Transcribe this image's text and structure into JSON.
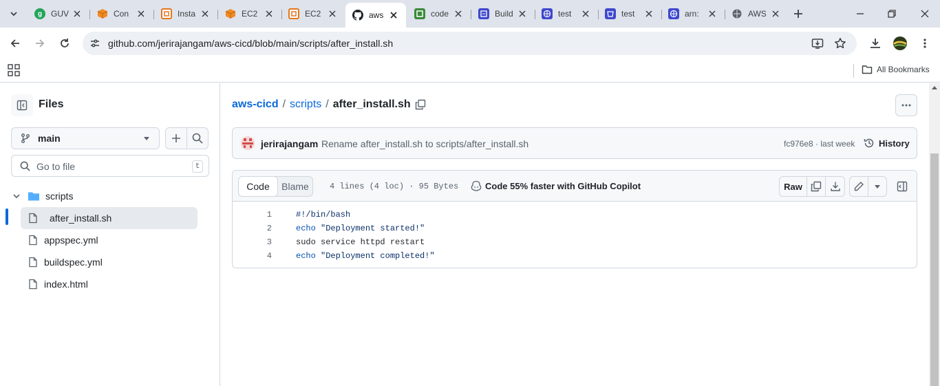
{
  "browser": {
    "tabs": [
      {
        "label": "GUVI",
        "favicon": "guvi-icon",
        "color": "#22a55b",
        "active": false
      },
      {
        "label": "Con",
        "favicon": "aws-cube-icon",
        "color": "#f08a24",
        "active": false
      },
      {
        "label": "Insta",
        "favicon": "aws-ec2-icon",
        "color": "#e2771f",
        "active": false
      },
      {
        "label": "EC2",
        "favicon": "aws-cube-icon",
        "color": "#f08a24",
        "active": false
      },
      {
        "label": "EC2",
        "favicon": "aws-ec2-icon",
        "color": "#e2771f",
        "active": false
      },
      {
        "label": "aws",
        "favicon": "github-icon",
        "color": "#1f2328",
        "active": true
      },
      {
        "label": "code",
        "favicon": "codecommit-icon",
        "color": "#3a8a3a",
        "active": false
      },
      {
        "label": "Build",
        "favicon": "codebuild-icon",
        "color": "#3f48cc",
        "active": false
      },
      {
        "label": "test",
        "favicon": "globe-icon",
        "color": "#3f48cc",
        "active": false
      },
      {
        "label": "test",
        "favicon": "bucket-icon",
        "color": "#3f48cc",
        "active": false
      },
      {
        "label": "arn:",
        "favicon": "globe-icon",
        "color": "#3f48cc",
        "active": false
      },
      {
        "label": "AWS",
        "favicon": "globe-icon",
        "color": "#5f6368",
        "active": false
      }
    ],
    "url": "github.com/jerirajangam/aws-cicd/blob/main/scripts/after_install.sh",
    "bookmarks_label": "All Bookmarks"
  },
  "sidebar": {
    "title": "Files",
    "branch": "main",
    "goto_placeholder": "Go to file",
    "goto_shortcut": "t",
    "tree": {
      "folder": "scripts",
      "selected_file": "after_install.sh",
      "files": [
        "appspec.yml",
        "buildspec.yml",
        "index.html"
      ]
    }
  },
  "breadcrumb": {
    "repo": "aws-cicd",
    "folder": "scripts",
    "file": "after_install.sh",
    "separator": "/"
  },
  "commit": {
    "author": "jerirajangam",
    "message": "Rename after_install.sh to scripts/after_install.sh",
    "meta": "fc976e8 · last week",
    "history_label": "History"
  },
  "code_view": {
    "tabs": [
      "Code",
      "Blame"
    ],
    "active_tab": "Code",
    "file_info": "4 lines (4 loc) · 95 Bytes",
    "copilot_label": "Code 55% faster with GitHub Copilot",
    "raw_label": "Raw",
    "lines": [
      {
        "n": "1",
        "kw": "",
        "rest": "#!/bin/bash"
      },
      {
        "n": "2",
        "kw": "echo",
        "rest": " \"Deployment started!\""
      },
      {
        "n": "3",
        "kw": "",
        "rest": "sudo service httpd restart"
      },
      {
        "n": "4",
        "kw": "echo",
        "rest": " \"Deployment completed!\""
      }
    ]
  },
  "colors": {
    "link": "#0969da",
    "keyword": "#0550ae",
    "folder": "#54aeff"
  }
}
